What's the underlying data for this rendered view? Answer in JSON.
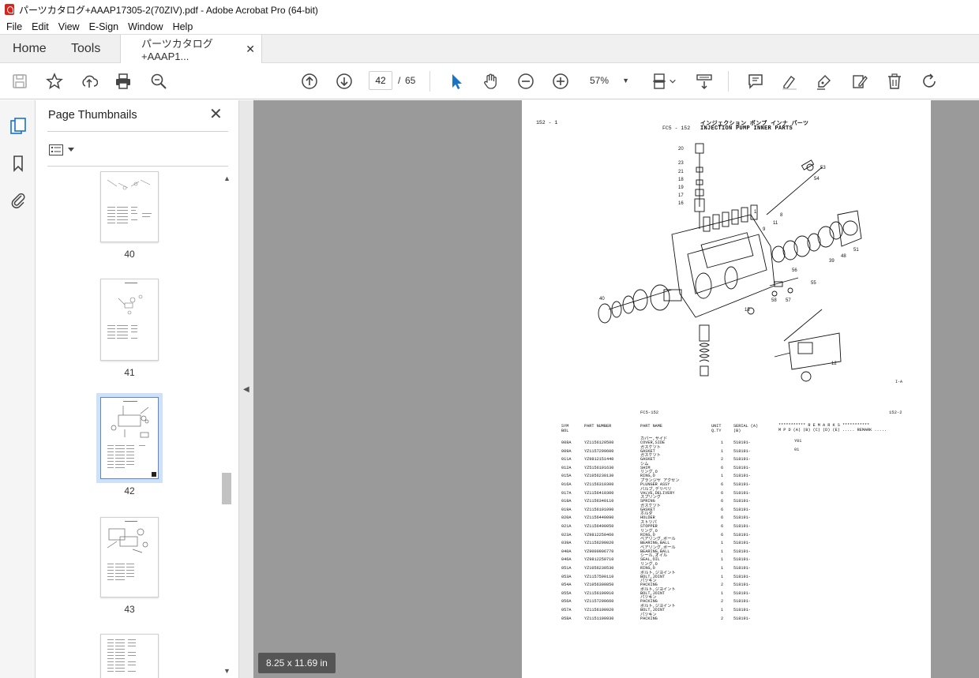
{
  "window": {
    "title": "パーツカタログ+AAAP17305-2(70ZIV).pdf - Adobe Acrobat Pro (64-bit)"
  },
  "menu": [
    "File",
    "Edit",
    "View",
    "E-Sign",
    "Window",
    "Help"
  ],
  "tabs": {
    "home": "Home",
    "tools": "Tools",
    "document": "パーツカタログ+AAAP1..."
  },
  "toolbar": {
    "current_page": "42",
    "page_sep": "/",
    "total_pages": "65",
    "zoom": "57%"
  },
  "thumbnails_panel": {
    "title": "Page Thumbnails",
    "pages": [
      "40",
      "41",
      "42",
      "43"
    ]
  },
  "status": {
    "page_size": "8.25 x 11.69 in"
  },
  "colors": {
    "accent_blue": "#1a73c7",
    "selection_outline": "#cfe1f7",
    "doc_background": "#9a9a9a"
  },
  "document_page": {
    "page_ref_left": "152 - 1",
    "model_code": "FC5 - 152",
    "title_jp": "インジェクション ポンプ インナ パーツ",
    "title_en": "INJECTION PUMP INNER PARTS",
    "figure_mark": "I-A",
    "callouts": [
      "20",
      "23",
      "21",
      "18",
      "19",
      "17",
      "16",
      "53",
      "54",
      "8",
      "11",
      "9",
      "1",
      "39",
      "48",
      "51",
      "56",
      "55",
      "58",
      "57",
      "15",
      "40",
      "12"
    ],
    "table_model": "FC5-152",
    "table_ref": "152-2",
    "header": {
      "sym": "SYM BOL",
      "part_number": "PART NUMBER",
      "part_name": "PART NAME",
      "unit_qty": "UNIT Q.TY",
      "serial": "SERIAL (A)  (B)",
      "remarks": "*********** R E M A R K S ***********",
      "remarks_sub": "M P D (A) (B) (C) (D) (E)  .....  REMARK ....."
    },
    "rows": [
      {
        "sym": "008A",
        "pn": "YZ1156120500",
        "kana": "カバー,サイド",
        "name": "COVER,SIDE",
        "qty": "1",
        "serial": "518191-",
        "rem": "Y01"
      },
      {
        "sym": "009A",
        "pn": "YZ1157299600",
        "kana": "ガスケツト",
        "name": "GASKET",
        "qty": "1",
        "serial": "518191-",
        "rem": "01"
      },
      {
        "sym": "011A",
        "pn": "YZ9812151440",
        "kana": "ガスケツト",
        "name": "GASKET",
        "qty": "2",
        "serial": "518191-",
        "rem": ""
      },
      {
        "sym": "012A",
        "pn": "YZ5156191630",
        "kana": "シム",
        "name": "SHIM",
        "qty": "6",
        "serial": "518191-",
        "rem": ""
      },
      {
        "sym": "015A",
        "pn": "YZ1056230130",
        "kana": "リング,O",
        "name": "RING,O",
        "qty": "1",
        "serial": "518191-",
        "rem": ""
      },
      {
        "sym": "016A",
        "pn": "YZ1156310300",
        "kana": "プランジヤ アクセン",
        "name": "PLUNGER ASSY",
        "qty": "6",
        "serial": "518191-",
        "rem": ""
      },
      {
        "sym": "017A",
        "pn": "YZ1156410300",
        "kana": "バルブ,デリベリ",
        "name": "VALVE,DELIVERY",
        "qty": "6",
        "serial": "518191-",
        "rem": ""
      },
      {
        "sym": "018A",
        "pn": "YZ1156340110",
        "kana": "スプリング",
        "name": "SPRING",
        "qty": "6",
        "serial": "518191-",
        "rem": ""
      },
      {
        "sym": "019A",
        "pn": "YZ1156191090",
        "kana": "ガスケツト",
        "name": "GASKET",
        "qty": "6",
        "serial": "518191-",
        "rem": ""
      },
      {
        "sym": "020A",
        "pn": "YZ1156440090",
        "kana": "ホルダ",
        "name": "HOLDER",
        "qty": "6",
        "serial": "518191-",
        "rem": ""
      },
      {
        "sym": "021A",
        "pn": "YZ1156490050",
        "kana": "ストツパ",
        "name": "STOPPER",
        "qty": "6",
        "serial": "518191-",
        "rem": ""
      },
      {
        "sym": "023A",
        "pn": "YZ9812250460",
        "kana": "リング,O",
        "name": "RING,O",
        "qty": "6",
        "serial": "518191-",
        "rem": ""
      },
      {
        "sym": "039A",
        "pn": "YZ1156290020",
        "kana": "ベアリング,ボール",
        "name": "BEARING,BALL",
        "qty": "1",
        "serial": "518191-",
        "rem": ""
      },
      {
        "sym": "040A",
        "pn": "YZ9000906770",
        "kana": "ベアリング,ボール",
        "name": "BEARING,BALL",
        "qty": "1",
        "serial": "518191-",
        "rem": ""
      },
      {
        "sym": "046A",
        "pn": "YZ9812250710",
        "kana": "シール,オイル",
        "name": "SEAL,OIL",
        "qty": "1",
        "serial": "518191-",
        "rem": ""
      },
      {
        "sym": "051A",
        "pn": "YZ1056230530",
        "kana": "リング,O",
        "name": "RING,O",
        "qty": "1",
        "serial": "518191-",
        "rem": ""
      },
      {
        "sym": "053A",
        "pn": "YZ1157590110",
        "kana": "ボルト,ジヨイント",
        "name": "BOLT,JOINT",
        "qty": "1",
        "serial": "518191-",
        "rem": ""
      },
      {
        "sym": "054A",
        "pn": "YZ1056300850",
        "kana": "パツキン",
        "name": "PACKING",
        "qty": "2",
        "serial": "518191-",
        "rem": ""
      },
      {
        "sym": "055A",
        "pn": "YZ1156190910",
        "kana": "ボルト,ジヨイント",
        "name": "BOLT,JOINT",
        "qty": "1",
        "serial": "518191-",
        "rem": ""
      },
      {
        "sym": "056A",
        "pn": "YZ1157290660",
        "kana": "パツキン",
        "name": "PACKING",
        "qty": "2",
        "serial": "518191-",
        "rem": ""
      },
      {
        "sym": "057A",
        "pn": "YZ1156190920",
        "kana": "ボルト,ジヨイント",
        "name": "BOLT,JOINT",
        "qty": "1",
        "serial": "518191-",
        "rem": ""
      },
      {
        "sym": "058A",
        "pn": "YZ1151190930",
        "kana": "パツキン",
        "name": "PACKING",
        "qty": "2",
        "serial": "518191-",
        "rem": ""
      }
    ]
  }
}
